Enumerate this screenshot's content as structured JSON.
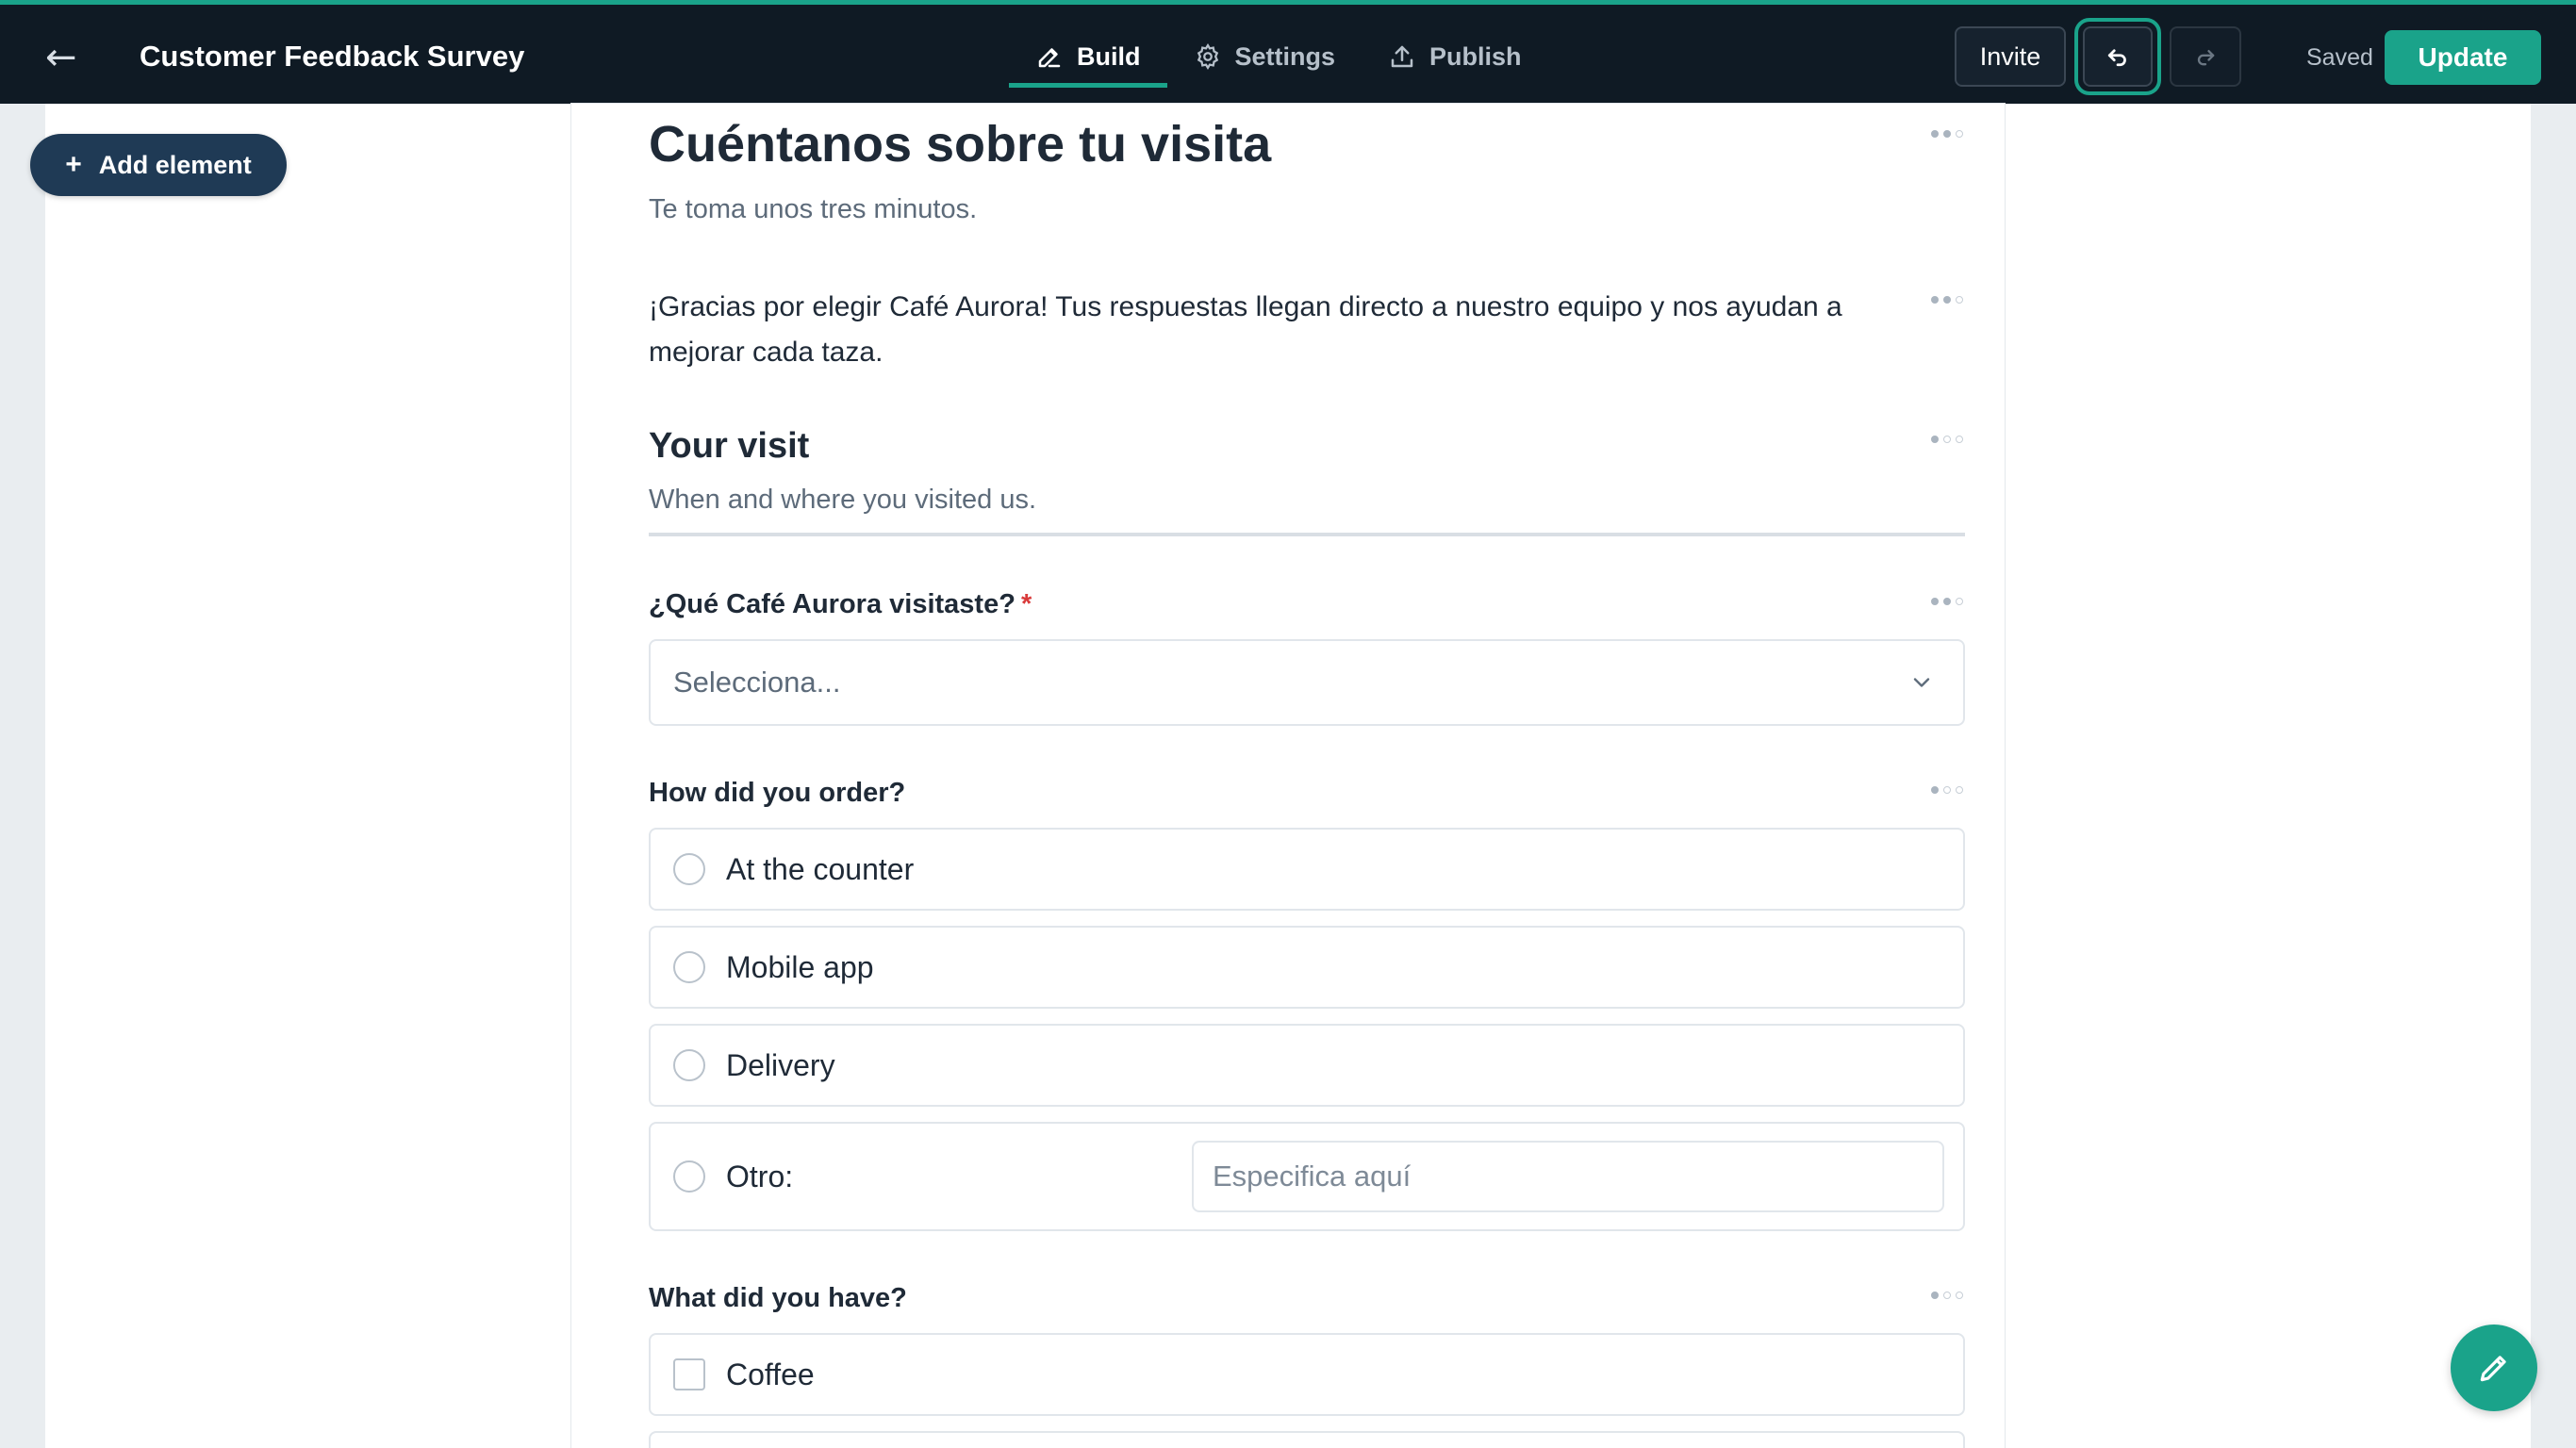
{
  "header": {
    "back_icon": "arrow-left-icon",
    "title": "Customer Feedback Survey",
    "tabs": [
      {
        "label": "Build",
        "icon": "pencil-icon",
        "active": true
      },
      {
        "label": "Settings",
        "icon": "gear-icon",
        "active": false
      },
      {
        "label": "Publish",
        "icon": "upload-icon",
        "active": false
      }
    ],
    "invite_label": "Invite",
    "undo_icon": "undo-icon",
    "redo_icon": "redo-icon",
    "status": "Saved",
    "update_label": "Update"
  },
  "sidebar": {
    "add_element_label": "Add element"
  },
  "form": {
    "title": "Cuéntanos sobre tu visita",
    "subtitle": "Te toma unos tres minutos.",
    "intro": "¡Gracias por elegir Café Aurora! Tus respuestas llegan directo a nuestro equipo y nos ayudan a mejorar cada taza.",
    "section": {
      "title": "Your visit",
      "description": "When and where you visited us."
    },
    "q_location": {
      "label": "¿Qué Café Aurora visitaste?",
      "required_mark": "*",
      "placeholder": "Selecciona..."
    },
    "q_order": {
      "label": "How did you order?",
      "options": [
        "At the counter",
        "Mobile app",
        "Delivery"
      ],
      "other_label": "Otro:",
      "other_placeholder": "Especifica aquí"
    },
    "q_items": {
      "label": "What did you have?",
      "options": [
        "Coffee"
      ]
    }
  },
  "colors": {
    "accent": "#1aa38a",
    "topbar": "#0f1a24",
    "required": "#d93a3a"
  }
}
